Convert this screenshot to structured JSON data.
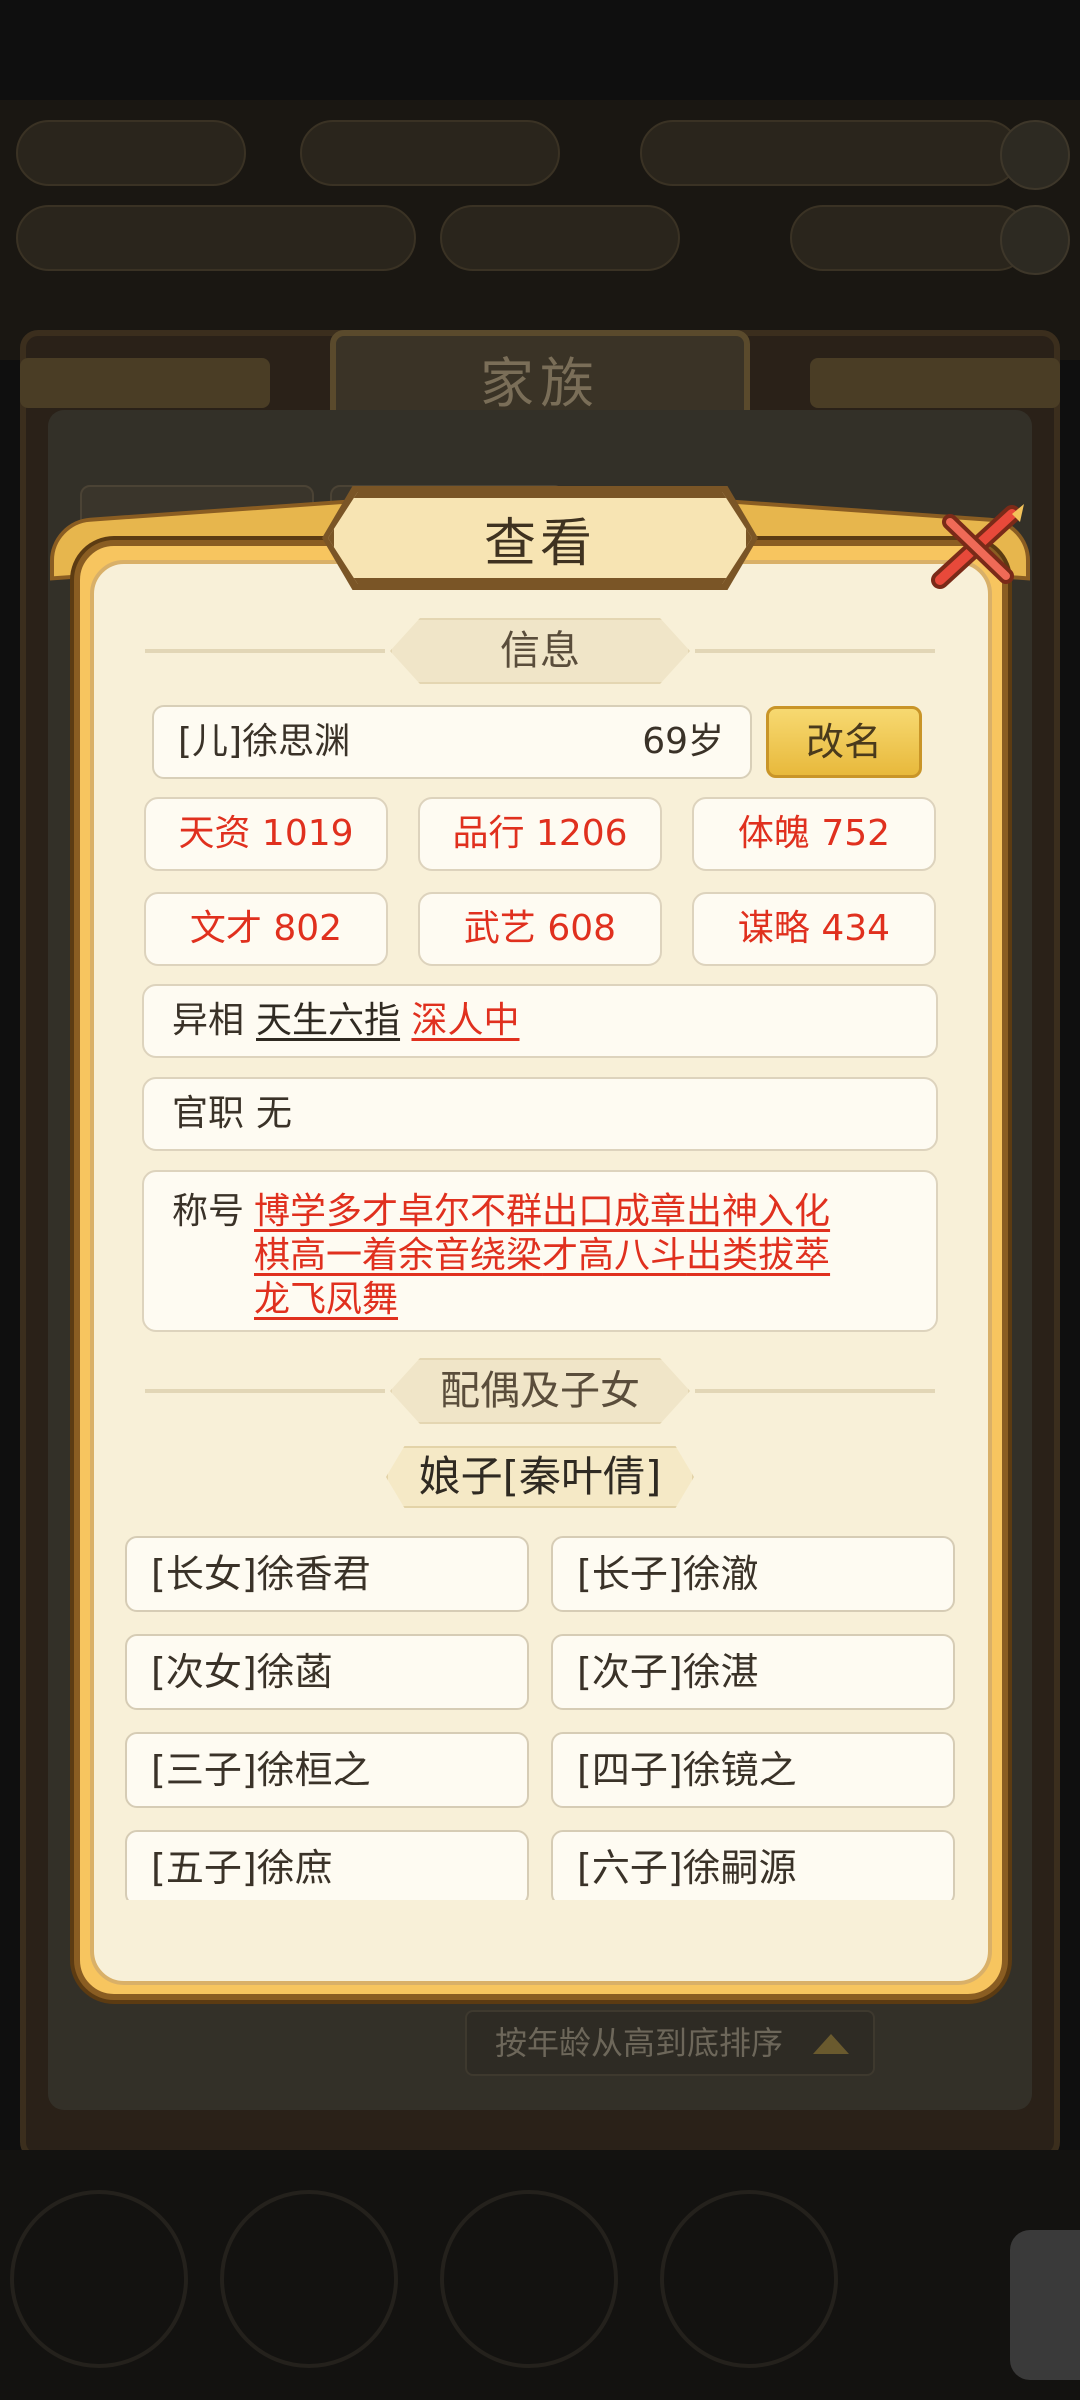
{
  "background": {
    "tabs_header": "家族",
    "sort_label": "按年龄从高到底排序"
  },
  "dialog": {
    "title": "查看",
    "info_section_label": "信息",
    "person": {
      "name": "[儿]徐思渊",
      "age": "69岁",
      "rename_label": "改名"
    },
    "stats": [
      {
        "label": "天资 1019"
      },
      {
        "label": "品行 1206"
      },
      {
        "label": "体魄 752"
      },
      {
        "label": "文才 802"
      },
      {
        "label": "武艺 608"
      },
      {
        "label": "谋略 434"
      }
    ],
    "traits": {
      "label": "异相",
      "items": [
        "天生六指",
        "深人中"
      ]
    },
    "office": {
      "label": "官职",
      "value": "无"
    },
    "honors": {
      "label": "称号",
      "items": [
        "博学多才",
        "卓尔不群",
        "出口成章",
        "出神入化",
        "棋高一着",
        "余音绕梁",
        "才高八斗",
        "出类拔萃",
        "龙飞凤舞"
      ]
    },
    "family_section_label": "配偶及子女",
    "spouse": "娘子[秦叶倩]",
    "children": [
      "[长女]徐香君",
      "[长子]徐澈",
      "[次女]徐菡",
      "[次子]徐湛",
      "[三子]徐桓之",
      "[四子]徐镜之",
      "[五子]徐庶",
      "[六子]徐嗣源"
    ]
  },
  "colors": {
    "accent_red": "#e0301e",
    "frame_gold": "#f7c55f",
    "panel_bg": "#f8f0d8"
  }
}
